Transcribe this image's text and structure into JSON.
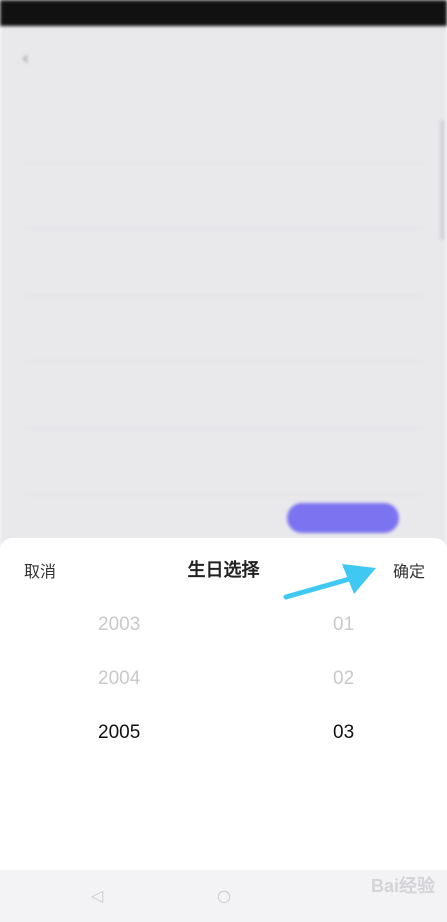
{
  "sheet": {
    "cancel_label": "取消",
    "title": "生日选择",
    "confirm_label": "确定"
  },
  "picker": {
    "years": [
      "2003",
      "2004",
      "2005"
    ],
    "months": [
      "01",
      "02",
      "03"
    ],
    "selected_year": "2005",
    "selected_month": "03"
  },
  "colors": {
    "annotation_arrow": "#3ec8f2",
    "pill_accent": "#7b73f0"
  },
  "watermark": {
    "brand": "Bai经验"
  }
}
